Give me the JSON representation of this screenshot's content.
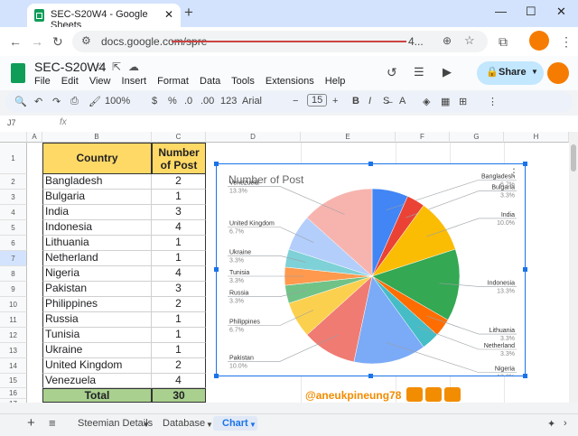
{
  "browser": {
    "tab_title": "SEC-S20W4 - Google Sheets",
    "url_start": "docs.google.com/spre",
    "url_end": "4...",
    "new_tab": "+",
    "min": "—",
    "max": "☐",
    "close": "✕"
  },
  "doc": {
    "title": "SEC-S20W4",
    "menus": [
      "File",
      "Edit",
      "View",
      "Insert",
      "Format",
      "Data",
      "Tools",
      "Extensions",
      "Help"
    ],
    "share_label": "Share"
  },
  "toolbar": {
    "zoom": "100%",
    "currency": "$",
    "percent": "%",
    "dec_dec": ".0",
    "dec_inc": ".00",
    "num_fmt": "123",
    "font": "Arial",
    "font_size": "15",
    "bold": "B",
    "italic": "I"
  },
  "formula_bar": {
    "cell_ref": "J7",
    "fx": "fx"
  },
  "grid": {
    "columns": [
      "A",
      "B",
      "C",
      "D",
      "E",
      "F",
      "G",
      "H"
    ],
    "rows": [
      "1",
      "2",
      "3",
      "4",
      "5",
      "6",
      "7",
      "8",
      "9",
      "10",
      "11",
      "12",
      "13",
      "14",
      "15",
      "16",
      "17"
    ],
    "header": {
      "country": "Country",
      "posts": "Number of Post"
    },
    "data": [
      {
        "country": "Bangladesh",
        "posts": "2"
      },
      {
        "country": "Bulgaria",
        "posts": "1"
      },
      {
        "country": "India",
        "posts": "3"
      },
      {
        "country": "Indonesia",
        "posts": "4"
      },
      {
        "country": "Lithuania",
        "posts": "1"
      },
      {
        "country": "Netherland",
        "posts": "1"
      },
      {
        "country": "Nigeria",
        "posts": "4"
      },
      {
        "country": "Pakistan",
        "posts": "3"
      },
      {
        "country": "Philippines",
        "posts": "2"
      },
      {
        "country": "Russia",
        "posts": "1"
      },
      {
        "country": "Tunisia",
        "posts": "1"
      },
      {
        "country": "Ukraine",
        "posts": "1"
      },
      {
        "country": "United Kingdom",
        "posts": "2"
      },
      {
        "country": "Venezuela",
        "posts": "4"
      }
    ],
    "total": {
      "label": "Total",
      "value": "30"
    }
  },
  "chart_data": {
    "type": "pie",
    "title": "Number of Post",
    "slices": [
      {
        "label": "Bangladesh",
        "value": 2,
        "pct": "6.7%",
        "color": "#4285f4"
      },
      {
        "label": "Bulgaria",
        "value": 1,
        "pct": "3.3%",
        "color": "#ea4335"
      },
      {
        "label": "India",
        "value": 3,
        "pct": "10.0%",
        "color": "#fbbc04"
      },
      {
        "label": "Indonesia",
        "value": 4,
        "pct": "13.3%",
        "color": "#34a853"
      },
      {
        "label": "Lithuania",
        "value": 1,
        "pct": "3.3%",
        "color": "#ff6d01"
      },
      {
        "label": "Netherland",
        "value": 1,
        "pct": "3.3%",
        "color": "#46bdc6"
      },
      {
        "label": "Nigeria",
        "value": 4,
        "pct": "13.3%",
        "color": "#7baaf7"
      },
      {
        "label": "Pakistan",
        "value": 3,
        "pct": "10.0%",
        "color": "#f07b72"
      },
      {
        "label": "Philippines",
        "value": 2,
        "pct": "6.7%",
        "color": "#fcd04f"
      },
      {
        "label": "Russia",
        "value": 1,
        "pct": "3.3%",
        "color": "#71c287"
      },
      {
        "label": "Tunisia",
        "value": 1,
        "pct": "3.3%",
        "color": "#ff994d"
      },
      {
        "label": "Ukraine",
        "value": 1,
        "pct": "3.3%",
        "color": "#7ed1d7"
      },
      {
        "label": "United Kingdom",
        "value": 2,
        "pct": "6.7%",
        "color": "#b3cefb"
      },
      {
        "label": "Venezuela",
        "value": 4,
        "pct": "13.3%",
        "color": "#f7b4ae"
      }
    ]
  },
  "watermark": {
    "text": "@aneukpineung78"
  },
  "sheet_tabs": {
    "add": "+",
    "list": "≡",
    "tabs": [
      "Steemian Details",
      "Database",
      "Chart"
    ],
    "active": "Chart"
  },
  "colors": {
    "header_yellow": "#ffd966",
    "total_green": "#a9d08e",
    "accent": "#1a73e8"
  }
}
